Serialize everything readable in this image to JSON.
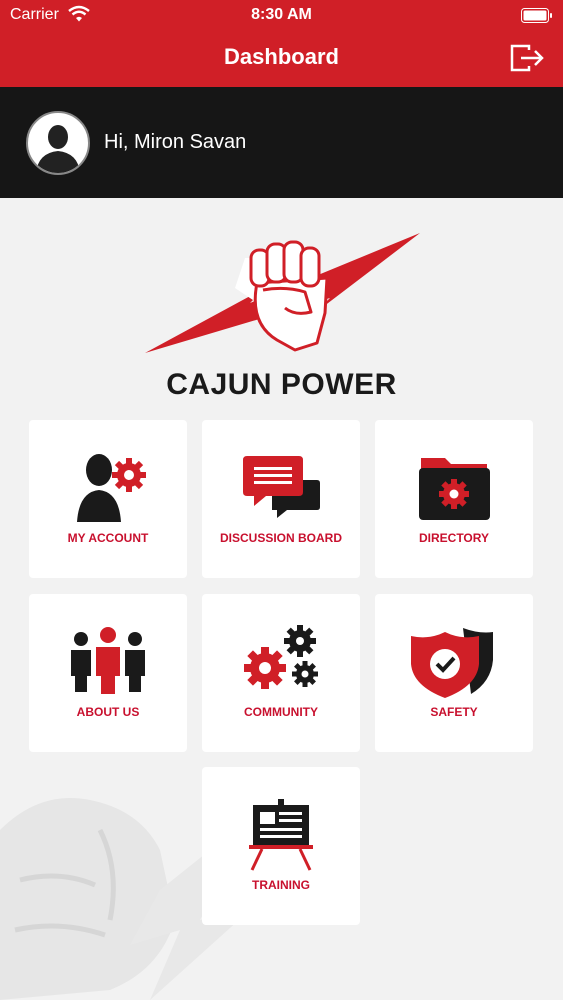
{
  "status_bar": {
    "carrier": "Carrier",
    "time": "8:30 AM"
  },
  "nav": {
    "title": "Dashboard",
    "logout_icon": "logout-icon"
  },
  "user": {
    "greeting": "Hi, Miron Savan",
    "avatar_icon": "user-avatar-icon"
  },
  "brand": {
    "name": "CAJUN POWER"
  },
  "colors": {
    "primary": "#d01f27",
    "dark": "#161616",
    "label": "#c8102e",
    "background": "#f2f2f2"
  },
  "tiles": [
    {
      "label": "MY ACCOUNT",
      "icon": "account-settings-icon"
    },
    {
      "label": "DISCUSSION BOARD",
      "icon": "chat-bubbles-icon"
    },
    {
      "label": "DIRECTORY",
      "icon": "folder-gear-icon"
    },
    {
      "label": "ABOUT US",
      "icon": "people-group-icon"
    },
    {
      "label": "COMMUNITY",
      "icon": "gears-icon"
    },
    {
      "label": "SAFETY",
      "icon": "shield-check-icon"
    },
    {
      "label": "TRAINING",
      "icon": "presentation-board-icon"
    }
  ]
}
